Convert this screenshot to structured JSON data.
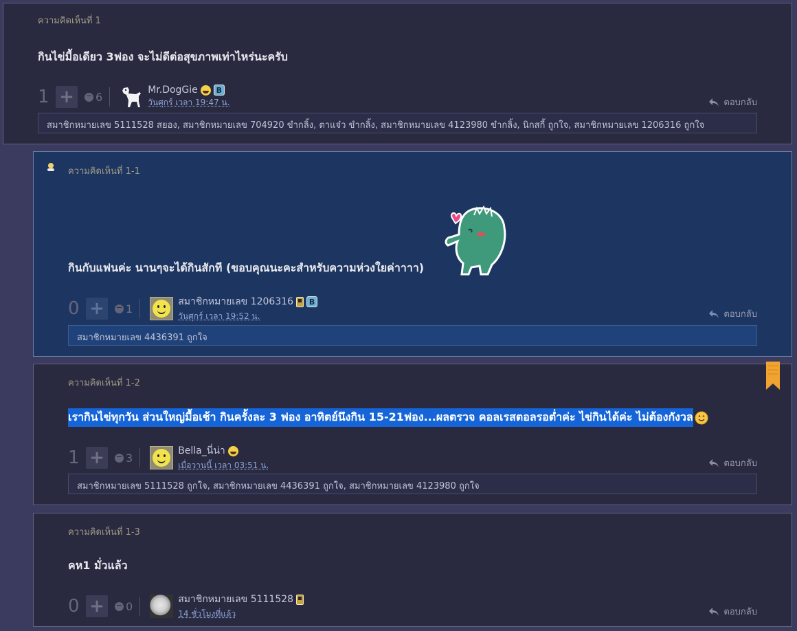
{
  "comments": [
    {
      "header": "ความคิดเห็นที่ 1",
      "body": "กินไข่มื้อเดียว 3ฟอง จะไม่ดีต่อสุขภาพเท่าไหร่นะครับ",
      "votes": "1",
      "emotion_count": "6",
      "username": "Mr.DogGie",
      "date": "วันศุกร์ เวลา 19:47 น.",
      "reply_label": "ตอบกลับ",
      "badge_letter": "B",
      "liked_by": "สมาชิกหมายเลข 5111528 สยอง, สมาชิกหมายเลข 704920 ขำกลิ้ง, ตาแจ๋ว ขำกลิ้ง, สมาชิกหมายเลข 4123980 ขำกลิ้ง, นิกสกี้ ถูกใจ, สมาชิกหมายเลข 1206316 ถูกใจ"
    },
    {
      "header": "ความคิดเห็นที่ 1-1",
      "body": "กินกับแฟนค่ะ นานๆจะได้กินสักที (ขอบคุณนะคะสำหรับความห่วงใยค่าาาา)",
      "votes": "0",
      "emotion_count": "1",
      "username": "สมาชิกหมายเลข 1206316",
      "date": "วันศุกร์ เวลา 19:52 น.",
      "reply_label": "ตอบกลับ",
      "badge_letter": "B",
      "liked_by": "สมาชิกหมายเลข 4436391 ถูกใจ"
    },
    {
      "header": "ความคิดเห็นที่ 1-2",
      "body": "เรากินไข่ทุกวัน ส่วนใหญ่มื้อเช้า กินครั้งละ 3 ฟอง อาทิตย์นึงกิน 15-21ฟอง...ผลตรวจ คอลเรสตอลรอต่ำค่ะ  ไข่กินได้ค่ะ ไม่ต้องกังวล",
      "votes": "1",
      "emotion_count": "3",
      "username": "Bella_นี่น่า",
      "date": "เมื่อวานนี้ เวลา 03:51 น.",
      "reply_label": "ตอบกลับ",
      "liked_by": "สมาชิกหมายเลข 5111528 ถูกใจ, สมาชิกหมายเลข 4436391 ถูกใจ, สมาชิกหมายเลข 4123980 ถูกใจ"
    },
    {
      "header": "ความคิดเห็นที่ 1-3",
      "body": "คห1 มั่วแล้ว",
      "votes": "0",
      "emotion_count": "0",
      "username": "สมาชิกหมายเลข 5111528",
      "date": "14 ชั่วโมงที่แล้ว",
      "reply_label": "ตอบกลับ"
    }
  ],
  "colors": {
    "page_bg": "#3b3b5f",
    "card_bg": "#292a40",
    "op_card_bg": "#1d3661",
    "highlight": "#1565d8",
    "bookmark": "#f0a330"
  }
}
